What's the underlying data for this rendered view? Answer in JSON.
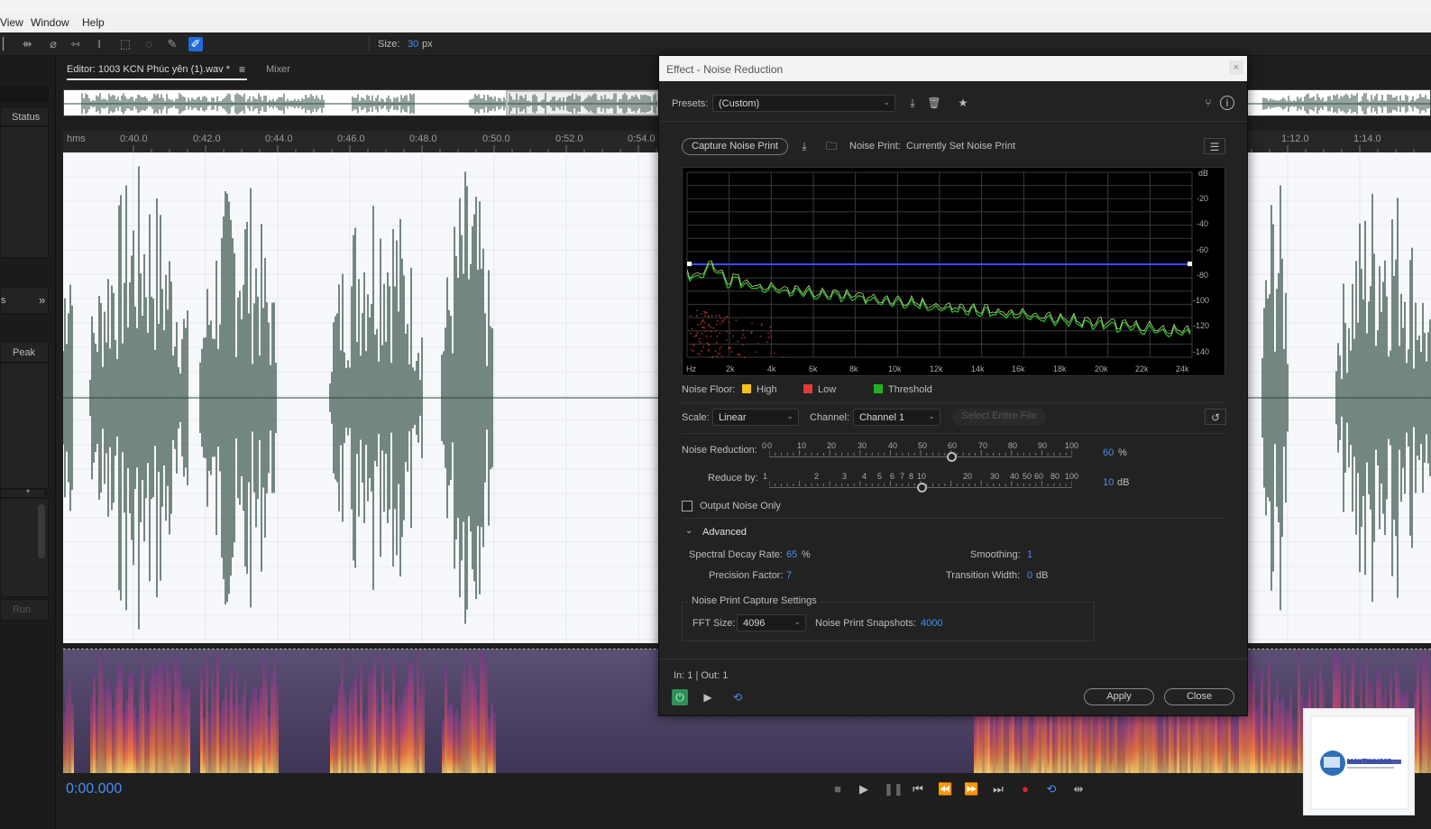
{
  "menu": {
    "items": [
      "View",
      "Window",
      "Help"
    ]
  },
  "toolbar": {
    "size_label": "Size:",
    "size_value": "30",
    "size_unit": "px"
  },
  "left_panel": {
    "status_label": "Status",
    "peak_label": "Peak",
    "run_label": "Run"
  },
  "editor": {
    "tab_label": "Editor: 1003 KCN Phúc yên (1).wav *",
    "mixer_label": "Mixer",
    "ruler_unit": "hms",
    "ruler_ticks": [
      "0:40.0",
      "0:42.0",
      "0:44.0",
      "0:46.0",
      "0:48.0",
      "0:50.0",
      "0:52.0",
      "0:54.0",
      "1:12.0",
      "1:14.0"
    ],
    "timecode": "0:00.000"
  },
  "dialog": {
    "title": "Effect - Noise Reduction",
    "presets_label": "Presets:",
    "presets_value": "(Custom)",
    "capture_button": "Capture Noise Print",
    "noise_print_label": "Noise Print:",
    "noise_print_value": "Currently Set Noise Print",
    "graph": {
      "db_labels": [
        "dB",
        "-20",
        "-40",
        "-60",
        "-80",
        "-100",
        "-120",
        "-140"
      ],
      "hz_labels": [
        "Hz",
        "2k",
        "4k",
        "6k",
        "8k",
        "10k",
        "12k",
        "14k",
        "16k",
        "18k",
        "20k",
        "22k",
        "24k"
      ]
    },
    "legend": {
      "label": "Noise Floor:",
      "items": [
        {
          "label": "High",
          "color": "#f2c21b"
        },
        {
          "label": "Low",
          "color": "#e03a3a"
        },
        {
          "label": "Threshold",
          "color": "#22b022"
        }
      ]
    },
    "scale_label": "Scale:",
    "scale_value": "Linear",
    "channel_label": "Channel:",
    "channel_value": "Channel 1",
    "select_entire_file": "Select Entire File",
    "noise_reduction": {
      "label": "Noise Reduction:",
      "scale": [
        "0",
        "0",
        "10",
        "20",
        "30",
        "40",
        "50",
        "60",
        "70",
        "80",
        "90",
        "100"
      ],
      "value": "60",
      "unit": "%"
    },
    "reduce_by": {
      "label": "Reduce by:",
      "scale": [
        "1",
        "2",
        "3",
        "4",
        "5",
        "6",
        "7",
        "8",
        "10",
        "20",
        "30",
        "40",
        "50",
        "60",
        "80",
        "100"
      ],
      "value": "10",
      "unit": "dB"
    },
    "output_noise_only": "Output Noise Only",
    "advanced": {
      "label": "Advanced",
      "spectral_decay_label": "Spectral Decay Rate:",
      "spectral_decay_value": "65",
      "spectral_decay_unit": "%",
      "smoothing_label": "Smoothing:",
      "smoothing_value": "1",
      "precision_label": "Precision Factor:",
      "precision_value": "7",
      "transition_label": "Transition Width:",
      "transition_value": "0",
      "transition_unit": "dB"
    },
    "capture_settings": {
      "label": "Noise Print Capture Settings",
      "fft_label": "FFT Size:",
      "fft_value": "4096",
      "snapshots_label": "Noise Print Snapshots:",
      "snapshots_value": "4000"
    },
    "io_label": "In: 1 | Out: 1",
    "apply_button": "Apply",
    "close_button": "Close"
  },
  "watermark": {
    "brand": "MAYTINH365"
  },
  "colors": {
    "accent": "#4a8ef0",
    "waveform": "#2e4a3e",
    "threshold_line": "#3a4cff"
  }
}
